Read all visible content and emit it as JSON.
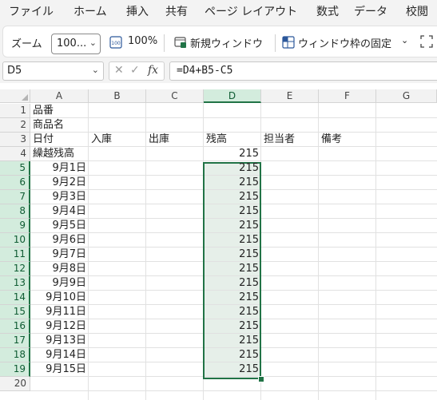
{
  "menu": [
    "ファイル",
    "ホーム",
    "挿入",
    "共有",
    "ページ レイアウト",
    "数式",
    "データ",
    "校閲"
  ],
  "ribbon": {
    "zoom_label": "ズーム",
    "zoom_value": "100...",
    "zoom_100_label": "100%",
    "new_window_label": "新規ウィンドウ",
    "freeze_panes_label": "ウィンドウ枠の固定"
  },
  "formula_bar": {
    "name_box": "D5",
    "fx_label": "fx",
    "formula": "=D4+B5-C5"
  },
  "columns": [
    "A",
    "B",
    "C",
    "D",
    "E",
    "F",
    "G"
  ],
  "selected_column": "D",
  "rows": [
    "1",
    "2",
    "3",
    "4",
    "5",
    "6",
    "7",
    "8",
    "9",
    "10",
    "11",
    "12",
    "13",
    "14",
    "15",
    "16",
    "17",
    "18",
    "19",
    "20"
  ],
  "selected_rows": [
    "5",
    "6",
    "7",
    "8",
    "9",
    "10",
    "11",
    "12",
    "13",
    "14",
    "15",
    "16",
    "17",
    "18",
    "19"
  ],
  "cells": {
    "A1": "品番",
    "A2": "商品名",
    "A3": "日付",
    "B3": "入庫",
    "C3": "出庫",
    "D3": "残高",
    "E3": "担当者",
    "F3": "備考",
    "A4": "繰越残高",
    "D4": "215",
    "A5": "9月1日",
    "D5": "215",
    "A6": "9月2日",
    "D6": "215",
    "A7": "9月3日",
    "D7": "215",
    "A8": "9月4日",
    "D8": "215",
    "A9": "9月5日",
    "D9": "215",
    "A10": "9月6日",
    "D10": "215",
    "A11": "9月7日",
    "D11": "215",
    "A12": "9月8日",
    "D12": "215",
    "A13": "9月9日",
    "D13": "215",
    "A14": "9月10日",
    "D14": "215",
    "A15": "9月11日",
    "D15": "215",
    "A16": "9月12日",
    "D16": "215",
    "A17": "9月13日",
    "D17": "215",
    "A18": "9月14日",
    "D18": "215",
    "A19": "9月15日",
    "D19": "215"
  },
  "colors": {
    "accent_green": "#217346",
    "selection_fill": "#e6efe9",
    "header_selected": "#d3ecdd"
  }
}
